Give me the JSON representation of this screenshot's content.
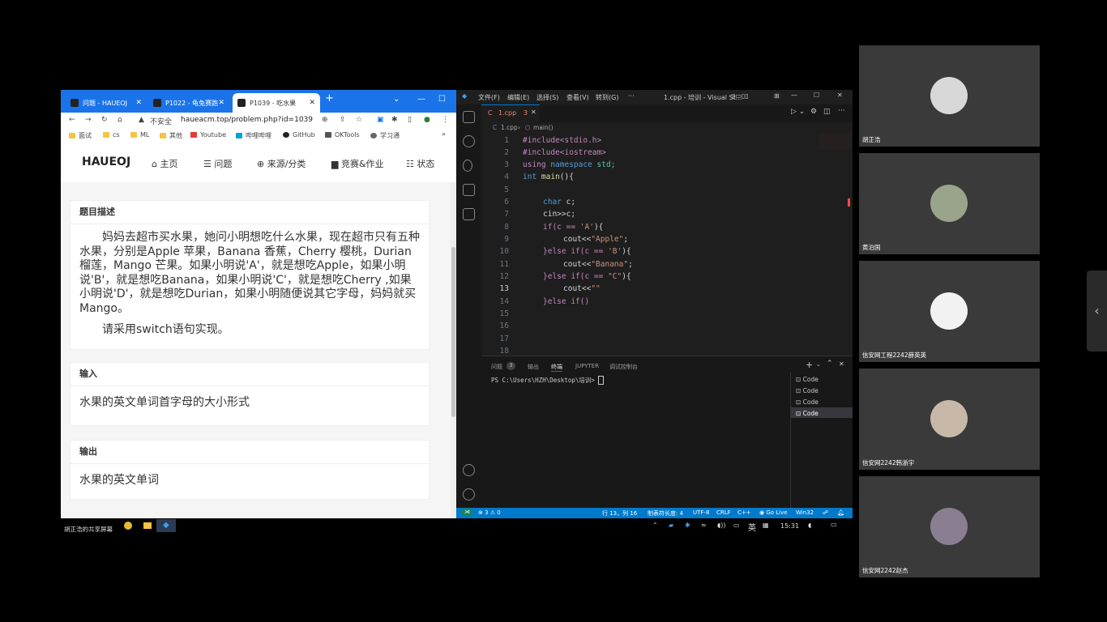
{
  "browser": {
    "tabs": [
      {
        "label": "问题 - HAUEOJ"
      },
      {
        "label": "P1022 - 龟兔赛跑"
      },
      {
        "label": "P1039 - 吃水果"
      }
    ],
    "new_tab": "+",
    "address": {
      "insecure": "不安全",
      "url": "haueacm.top/problem.php?id=1039"
    },
    "bookmarks": [
      "面试",
      "cs",
      "ML",
      "其他",
      "Youtube",
      "哔哩哔哩",
      "GitHub",
      "OKTools",
      "学习通"
    ],
    "bookmarks_more": "»"
  },
  "site": {
    "brand": "HAUEOJ",
    "nav": [
      "主页",
      "问题",
      "来源/分类",
      "竞赛&作业",
      "状态"
    ],
    "sections": {
      "desc_title": "题目描述",
      "desc_p1": "妈妈去超市买水果，她问小明想吃什么水果，现在超市只有五种水果，分别是Apple 苹果，Banana 香蕉，Cherry 樱桃，Durian 榴莲，Mango 芒果。如果小明说'A'，就是想吃Apple，如果小明说'B'，就是想吃Banana，如果小明说'C'，就是想吃Cherry ,如果小明说'D'，就是想吃Durian，如果小明随便说其它字母，妈妈就买Mango。",
      "desc_p2": "请采用switch语句实现。",
      "input_title": "输入",
      "input_text": "水果的英文单词首字母的大小形式",
      "output_title": "输出",
      "output_text": "水果的英文单词"
    }
  },
  "vscode": {
    "menu": [
      "文件(F)",
      "编辑(E)",
      "选择(S)",
      "查看(V)",
      "转到(G)",
      "···"
    ],
    "title": "1.cpp - 培训 - Visual St...",
    "tab": {
      "name": "1.cpp",
      "badge": "3"
    },
    "breadcrumb": {
      "file": "1.cpp",
      "symbol": "main()"
    },
    "lines": [
      "1",
      "2",
      "3",
      "4",
      "5",
      "6",
      "7",
      "8",
      "9",
      "10",
      "11",
      "12",
      "13",
      "14",
      "15",
      "16",
      "17",
      "18"
    ],
    "code": {
      "l1": "#include<stdio.h>",
      "l2": "#include<iostream>",
      "l3a": "using ",
      "l3b": "namespace ",
      "l3c": "std;",
      "l4a": "int ",
      "l4b": "main",
      "l4c": "(){",
      "l6a": "char ",
      "l6b": "c;",
      "l7": "cin>>c;",
      "l8a": "if(c == ",
      "l8b": "'A'",
      "l8c": "){",
      "l9a": "cout<<",
      "l9b": "\"Apple\"",
      "l9c": ";",
      "l10a": "}else if(c == ",
      "l10b": "'B'",
      "l10c": "){",
      "l11a": "cout<<",
      "l11b": "\"Banana\"",
      "l11c": ";",
      "l12a": "}else if(c == ",
      "l12b": "\"C\"",
      "l12c": "){",
      "l13a": "cout<<",
      "l13b": "\"\"",
      "l14": "}else if()"
    },
    "panel_tabs": [
      "问题",
      "输出",
      "终端",
      "JUPYTER",
      "调试控制台"
    ],
    "problems_count": "3",
    "terminal_prompt": "PS C:\\Users\\HZH\\Desktop\\培训> ",
    "terminals": [
      "Code",
      "Code",
      "Code",
      "Code"
    ],
    "status": {
      "errors": "⊗ 3 ⚠ 0",
      "position": "行 13，列 16",
      "tab_size": "制表符长度: 4",
      "encoding": "UTF-8",
      "eol": "CRLF",
      "language": "C++",
      "golive": "Go Live",
      "platform": "Win32"
    }
  },
  "taskbar": {
    "share_label": "胡正浩的共享屏幕",
    "ime": "英",
    "time": "15:31"
  },
  "participants": [
    {
      "name": "胡正浩"
    },
    {
      "name": "黄泊国"
    },
    {
      "name": "信安网工程2242薛英英"
    },
    {
      "name": "信安网2242韩浙宇"
    },
    {
      "name": "信安网2242赵杰"
    }
  ],
  "colors": {
    "accent": "#1a73e8",
    "vs_status": "#007acc",
    "stripe": [
      "#2e7dd1",
      "#43a047",
      "#f39c12",
      "#e53935",
      "#27ae60"
    ]
  }
}
